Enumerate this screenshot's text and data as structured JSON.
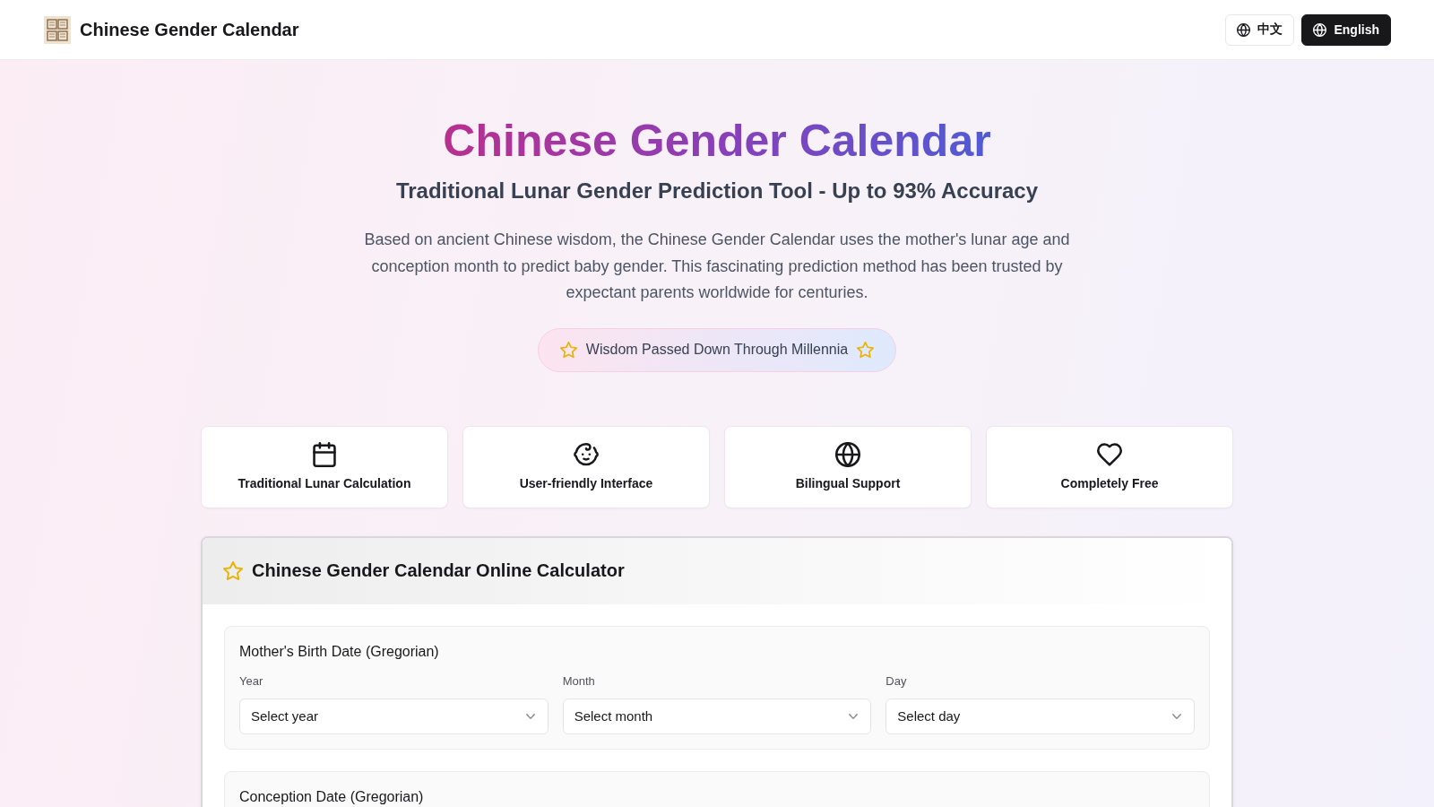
{
  "header": {
    "title": "Chinese Gender Calendar",
    "languages": [
      {
        "label": "中文",
        "selected": false
      },
      {
        "label": "English",
        "selected": true
      }
    ]
  },
  "hero": {
    "title": "Chinese Gender Calendar",
    "subtitle": "Traditional Lunar Gender Prediction Tool - Up to 93% Accuracy",
    "description": "Based on ancient Chinese wisdom, the Chinese Gender Calendar uses the mother's lunar age and conception month to predict baby gender. This fascinating prediction method has been trusted by expectant parents worldwide for centuries.",
    "badge": "Wisdom Passed Down Through Millennia"
  },
  "features": [
    {
      "label": "Traditional Lunar Calculation"
    },
    {
      "label": "User-friendly Interface"
    },
    {
      "label": "Bilingual Support"
    },
    {
      "label": "Completely Free"
    }
  ],
  "calculator": {
    "title": "Chinese Gender Calendar Online Calculator",
    "sections": [
      {
        "title": "Mother's Birth Date (Gregorian)",
        "fields": [
          {
            "label": "Year",
            "placeholder": "Select year"
          },
          {
            "label": "Month",
            "placeholder": "Select month"
          },
          {
            "label": "Day",
            "placeholder": "Select day"
          }
        ]
      },
      {
        "title": "Conception Date (Gregorian)"
      }
    ]
  }
}
